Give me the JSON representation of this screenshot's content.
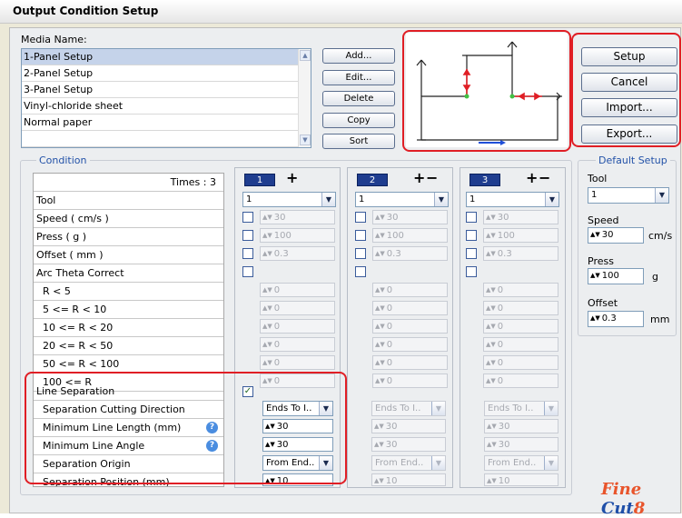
{
  "title": "Output Condition Setup",
  "media": {
    "label": "Media Name:",
    "items": [
      "1-Panel Setup",
      "2-Panel Setup",
      "3-Panel Setup",
      "Vinyl-chloride sheet",
      "Normal paper"
    ],
    "selected_index": 0
  },
  "media_buttons": {
    "add": "Add...",
    "edit": "Edit...",
    "delete": "Delete",
    "copy": "Copy",
    "sort": "Sort"
  },
  "action_buttons": {
    "setup": "Setup",
    "cancel": "Cancel",
    "import": "Import...",
    "export": "Export..."
  },
  "condition": {
    "title": "Condition",
    "times": "Times : 3",
    "rows": [
      "Tool",
      "Speed ( cm/s )",
      "Press ( g )",
      "Offset ( mm )",
      "Arc Theta Correct",
      "R < 5",
      "5 <= R < 10",
      "10 <= R < 20",
      "20 <= R < 50",
      "50 <= R < 100",
      "100 <= R"
    ],
    "sep_rows": [
      "Line Separation",
      "Separation Cutting Direction",
      "Minimum Line Length (mm)",
      "Minimum Line Angle",
      "Separation Origin",
      "Separation Position (mm)"
    ]
  },
  "columns": [
    {
      "num": "1",
      "plus": "+",
      "minus": "",
      "tool": "1",
      "speed": "30",
      "press": "100",
      "offset": "0.3",
      "arc": [
        "0",
        "0",
        "0",
        "0",
        "0",
        "0"
      ],
      "line_sep_checked": true,
      "direction": "Ends To I..",
      "min_len": "30",
      "min_angle": "30",
      "origin": "From End..",
      "position": "10"
    },
    {
      "num": "2",
      "plus": "+",
      "minus": "−",
      "tool": "1",
      "speed": "30",
      "press": "100",
      "offset": "0.3",
      "arc": [
        "0",
        "0",
        "0",
        "0",
        "0",
        "0"
      ],
      "line_sep_checked": false,
      "direction": "Ends To I..",
      "min_len": "30",
      "min_angle": "30",
      "origin": "From End..",
      "position": "10"
    },
    {
      "num": "3",
      "plus": "+",
      "minus": "−",
      "tool": "1",
      "speed": "30",
      "press": "100",
      "offset": "0.3",
      "arc": [
        "0",
        "0",
        "0",
        "0",
        "0",
        "0"
      ],
      "line_sep_checked": false,
      "direction": "Ends To I..",
      "min_len": "30",
      "min_angle": "30",
      "origin": "From End..",
      "position": "10"
    }
  ],
  "default_setup": {
    "title": "Default Setup",
    "tool_label": "Tool",
    "tool_value": "1",
    "speed_label": "Speed",
    "speed_value": "30",
    "speed_unit": "cm/s",
    "press_label": "Press",
    "press_value": "100",
    "press_unit": "g",
    "offset_label": "Offset",
    "offset_value": "0.3",
    "offset_unit": "mm"
  },
  "logo": {
    "part1": "Fine ",
    "part2": "Cut",
    "part3": "8"
  },
  "colors": {
    "highlight": "#e01e25",
    "selection": "#c5d3ea",
    "column_badge": "#1f3d8f"
  }
}
